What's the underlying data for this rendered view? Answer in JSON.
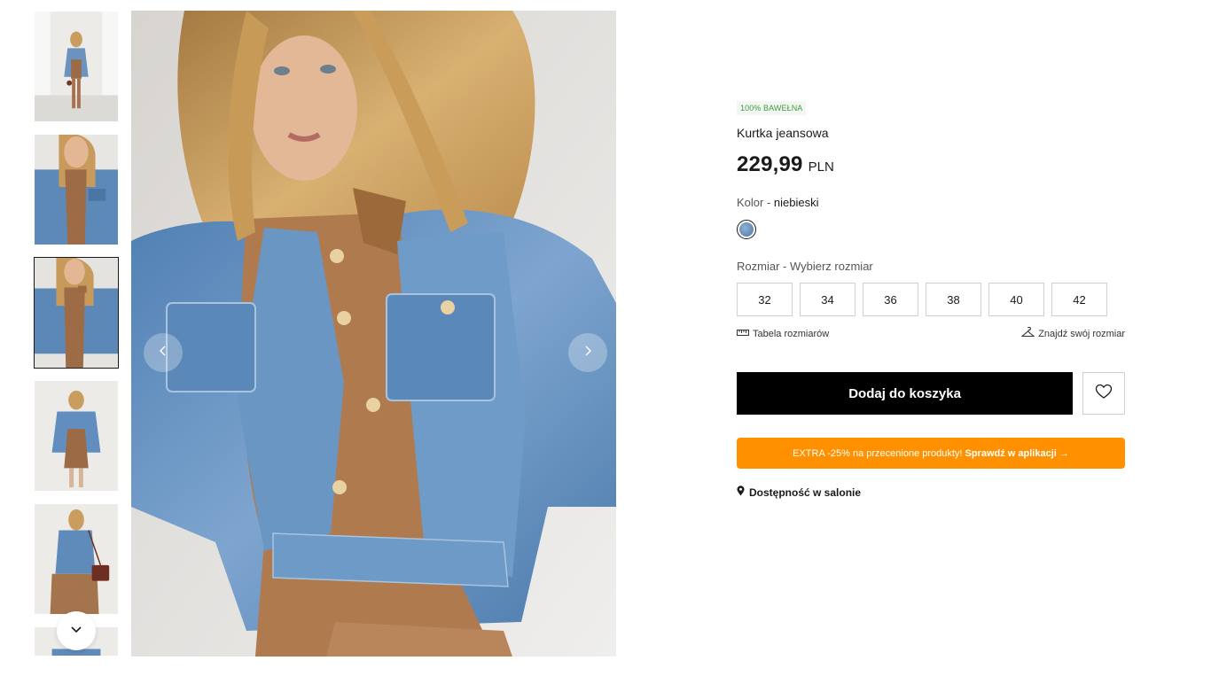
{
  "gallery": {
    "thumbnails": [
      {
        "name": "thumbnail-1",
        "active": false
      },
      {
        "name": "thumbnail-2",
        "active": false
      },
      {
        "name": "thumbnail-3",
        "active": true
      },
      {
        "name": "thumbnail-4",
        "active": false
      },
      {
        "name": "thumbnail-5",
        "active": false
      },
      {
        "name": "thumbnail-6",
        "active": false
      }
    ],
    "scroll_icon": "chevron-down-icon",
    "prev_icon": "chevron-left-icon",
    "next_icon": "chevron-right-icon"
  },
  "product": {
    "badge": "100% BAWEŁNA",
    "name": "Kurtka jeansowa",
    "price": "229,99",
    "currency": "PLN",
    "color_label": "Kolor -",
    "color_value": "niebieski",
    "color_swatch": "#5f86b4",
    "size_label": "Rozmiar -",
    "size_value": "Wybierz rozmiar",
    "sizes": [
      "32",
      "34",
      "36",
      "38",
      "40",
      "42"
    ],
    "size_chart": "Tabela rozmiarów",
    "find_size": "Znajdź swój rozmiar",
    "add_to_cart": "Dodaj do koszyka",
    "promo_text": "EXTRA -25% na przecenione produkty!",
    "promo_link": "Sprawdź w aplikacji →",
    "promo_color": "#ff9000",
    "availability": "Dostępność w salonie"
  }
}
